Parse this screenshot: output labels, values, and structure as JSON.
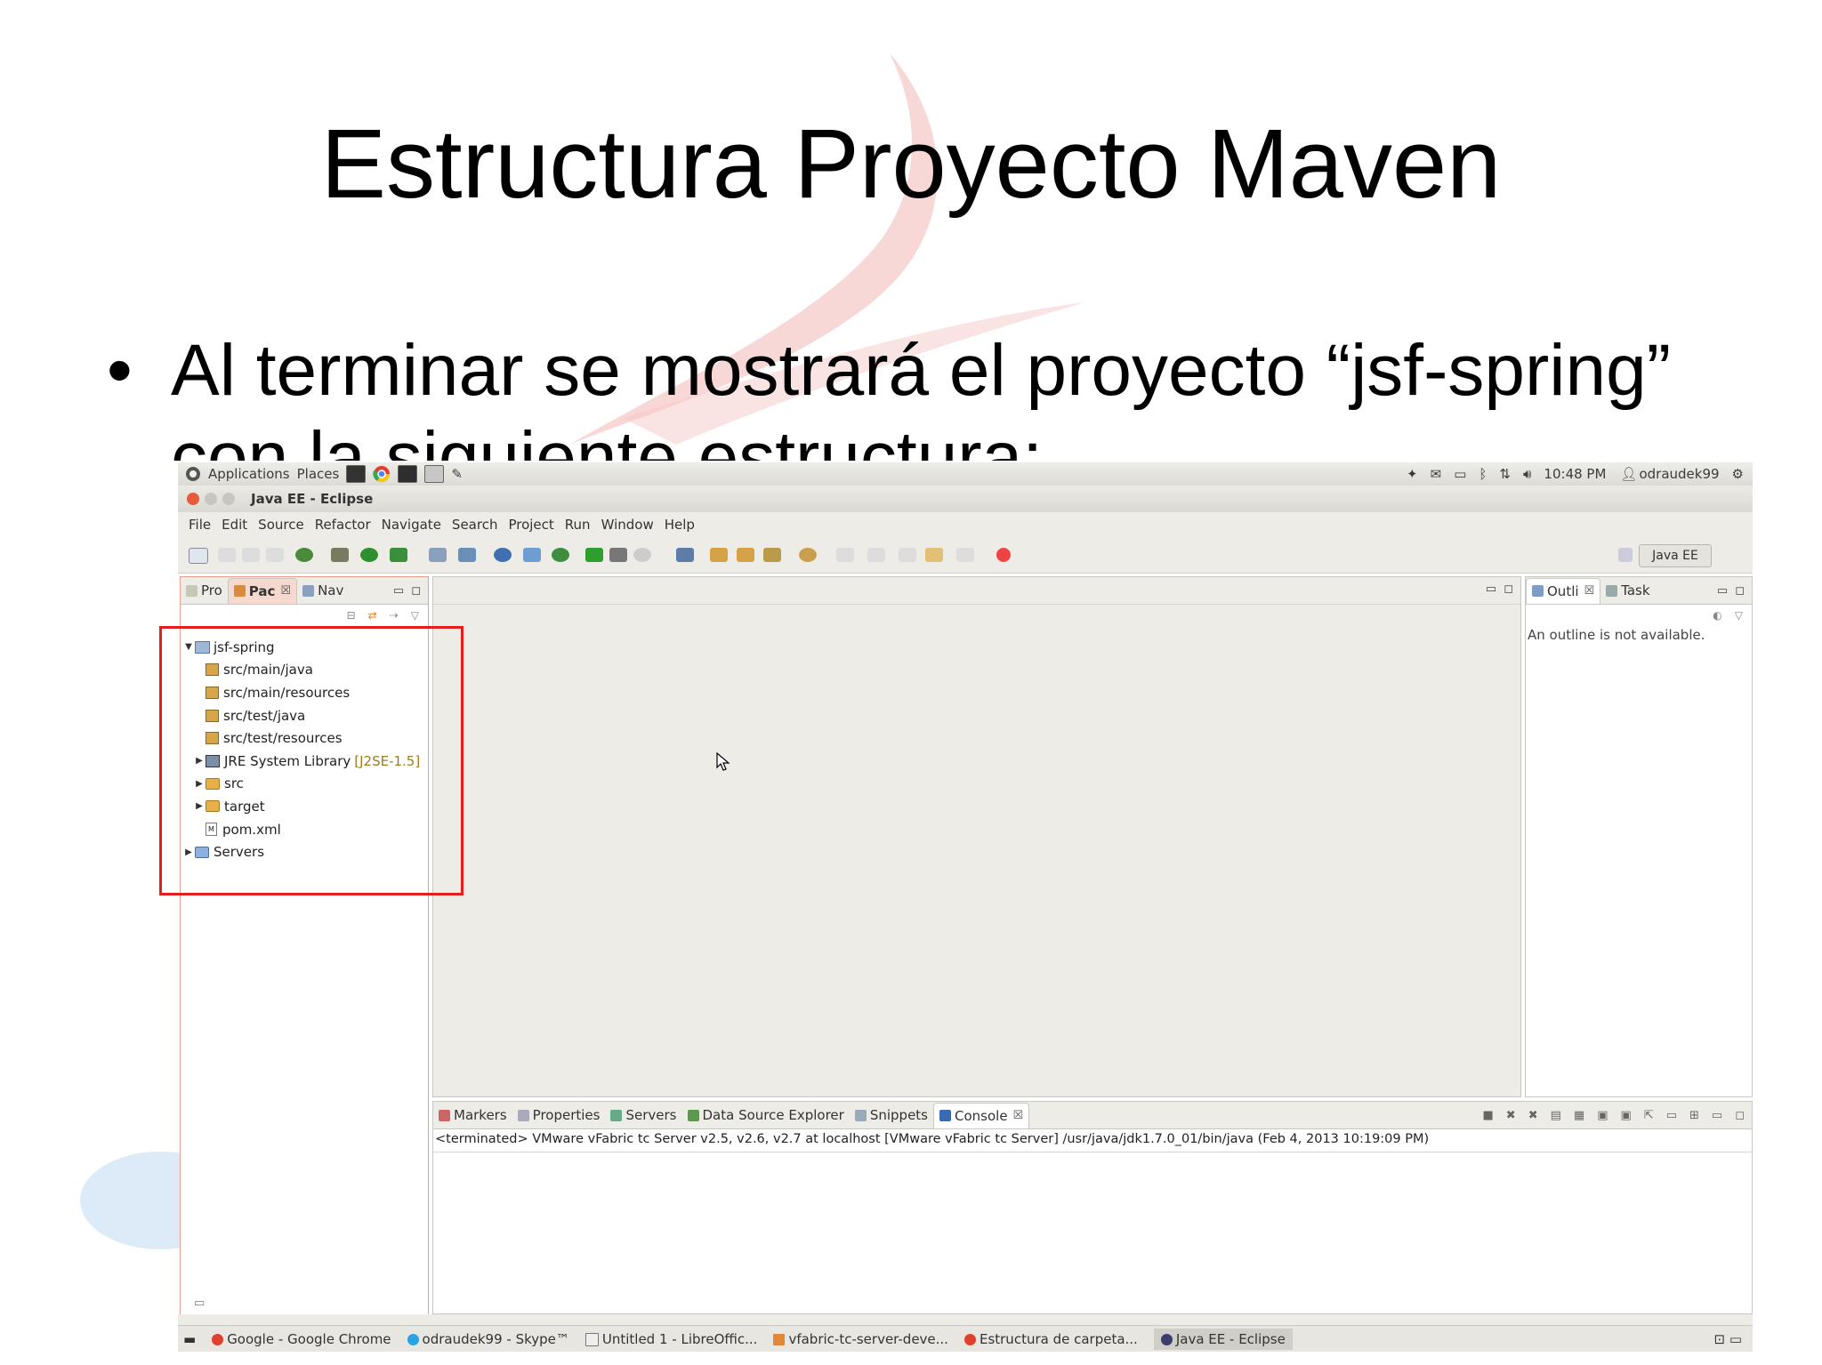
{
  "slide": {
    "title": "Estructura Proyecto Maven",
    "bullet": "Al terminar se mostrará el proyecto “jsf-spring” con la siguiente estructura:",
    "bullet_dot": "•"
  },
  "topbar": {
    "applications": "Applications",
    "places": "Places",
    "time": "10:48 PM",
    "user": "odraudek99"
  },
  "window": {
    "title": "Java EE - Eclipse"
  },
  "menu": [
    "File",
    "Edit",
    "Source",
    "Refactor",
    "Navigate",
    "Search",
    "Project",
    "Run",
    "Window",
    "Help"
  ],
  "perspective": "Java EE",
  "left_tabs": {
    "pro": "Pro",
    "pac": "Pac",
    "nav": "Nav"
  },
  "tree": {
    "project": "jsf-spring",
    "src_main_java": "src/main/java",
    "src_main_resources": "src/main/resources",
    "src_test_java": "src/test/java",
    "src_test_resources": "src/test/resources",
    "jre": "JRE System Library",
    "jre_version": "[J2SE-1.5]",
    "src": "src",
    "target": "target",
    "pom": "pom.xml",
    "servers": "Servers"
  },
  "outline": {
    "tab_outline": "Outli",
    "tab_task": "Task",
    "message": "An outline is not available."
  },
  "bottom_tabs": {
    "markers": "Markers",
    "properties": "Properties",
    "servers": "Servers",
    "dse": "Data Source Explorer",
    "snippets": "Snippets",
    "console": "Console"
  },
  "console_text": "<terminated> VMware vFabric tc Server v2.5, v2.6, v2.7 at localhost [VMware vFabric tc Server] /usr/java/jdk1.7.0_01/bin/java (Feb 4, 2013 10:19:09 PM)",
  "taskbar": {
    "chrome": "Google - Google Chrome",
    "skype": "odraudek99 - Skype™",
    "libre": "Untitled 1 - LibreOffic...",
    "vfabric": "vfabric-tc-server-deve...",
    "estructura": "Estructura de carpeta...",
    "eclipse": "Java EE - Eclipse"
  },
  "colors": {
    "highlight": "#e41d1d",
    "slide_swoosh": "#e33b3b"
  }
}
